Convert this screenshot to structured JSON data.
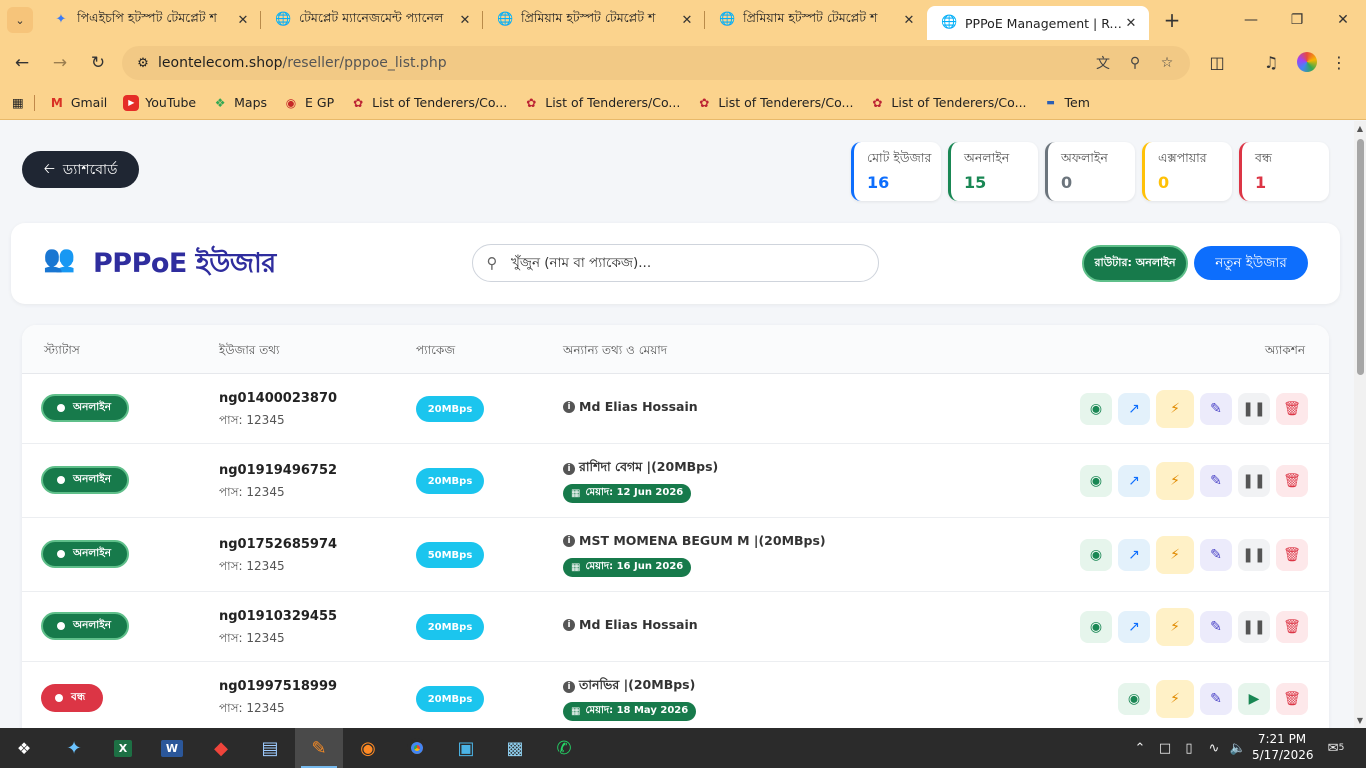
{
  "browser": {
    "tabs": [
      {
        "title": "পিএইচপি হটস্পট টেমপ্লেট শ",
        "icon": "gemini-star-icon"
      },
      {
        "title": "টেমপ্লেট ম্যানেজমেন্ট প্যানেল",
        "icon": "globe-icon"
      },
      {
        "title": "প্রিমিয়াম হটস্পট টেমপ্লেট শ",
        "icon": "globe-icon"
      },
      {
        "title": "প্রিমিয়াম হটস্পট টেমপ্লেট শ",
        "icon": "globe-icon"
      },
      {
        "title": "PPPoE Management | Resell",
        "icon": "globe-icon"
      }
    ],
    "url_domain": "leontelecom.shop",
    "url_path": "/reseller/pppoe_list.php",
    "bookmarks": [
      {
        "label": "Gmail",
        "icon": "gmail-icon"
      },
      {
        "label": "YouTube",
        "icon": "youtube-icon"
      },
      {
        "label": "Maps",
        "icon": "maps-icon"
      },
      {
        "label": "E GP",
        "icon": "egp-icon"
      },
      {
        "label": "List of Tenderers/Co...",
        "icon": "tender-icon"
      },
      {
        "label": "List of Tenderers/Co...",
        "icon": "tender-icon"
      },
      {
        "label": "List of Tenderers/Co...",
        "icon": "tender-icon"
      },
      {
        "label": "List of Tenderers/Co...",
        "icon": "tender-icon"
      },
      {
        "label": "Tem",
        "icon": "tem-icon"
      }
    ]
  },
  "page": {
    "dashboard_button": "ড্যাশবোর্ড",
    "title": "PPPoE ইউজার",
    "search_placeholder": "খুঁজুন (নাম বা প্যাকেজ)...",
    "router_status": "রাউটার: অনলাইন",
    "new_user_button": "নতুন ইউজার",
    "stats": [
      {
        "label": "মোট ইউজার",
        "value": "16",
        "color": "#0d6efd"
      },
      {
        "label": "অনলাইন",
        "value": "15",
        "color": "#198754"
      },
      {
        "label": "অফলাইন",
        "value": "0",
        "color": "#6c757d"
      },
      {
        "label": "এক্সপায়ার",
        "value": "0",
        "color": "#ffc107"
      },
      {
        "label": "বন্ধ",
        "value": "1",
        "color": "#dc3545"
      }
    ],
    "columns": {
      "status": "স্ট্যাটাস",
      "user_info": "ইউজার তথ্য",
      "package": "প্যাকেজ",
      "other_info": "অন্যান্য তথ্য ও মেয়াদ",
      "action": "অ্যাকশন"
    },
    "rows": [
      {
        "status": "অনলাইন",
        "username": "ng01400023870",
        "password": "পাস: 12345",
        "package": "20MBps",
        "info": "Md Elias Hossain",
        "expiry": ""
      },
      {
        "status": "অনলাইন",
        "username": "ng01919496752",
        "password": "পাস: 12345",
        "package": "20MBps",
        "info": "রাশিদা বেগম |(20MBps)",
        "expiry": "মেয়াদ: 12 Jun 2026"
      },
      {
        "status": "অনলাইন",
        "username": "ng01752685974",
        "password": "পাস: 12345",
        "package": "50MBps",
        "info": "MST MOMENA BEGUM M |(20MBps)",
        "expiry": "মেয়াদ: 16 Jun 2026"
      },
      {
        "status": "অনলাইন",
        "username": "ng01910329455",
        "password": "পাস: 12345",
        "package": "20MBps",
        "info": "Md Elias Hossain",
        "expiry": ""
      },
      {
        "status": "বন্ধ",
        "username": "ng01997518999",
        "password": "পাস: 12345",
        "package": "20MBps",
        "info": "তানভির |(20MBps)",
        "expiry": "মেয়াদ: 18 May 2026"
      }
    ]
  },
  "taskbar": {
    "time": "7:21 PM",
    "date": "5/17/2026",
    "notifications": "5"
  }
}
